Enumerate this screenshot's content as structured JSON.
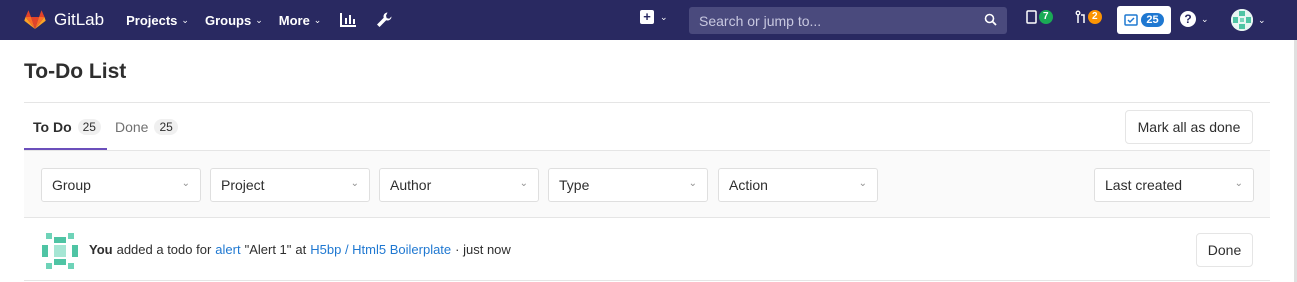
{
  "app": {
    "name": "GitLab",
    "brand_color": "#292961",
    "accent_color": "#6b4fbb"
  },
  "nav": {
    "menu": [
      {
        "label": "Projects",
        "chevron": "⌄"
      },
      {
        "label": "Groups",
        "chevron": "⌄"
      },
      {
        "label": "More",
        "chevron": "⌄"
      }
    ],
    "icons": [
      "activity-chart-icon",
      "wrench-icon"
    ],
    "new_chevron": "⌄",
    "search_placeholder": "Search or jump to...",
    "issues_count": "7",
    "merge_requests_count": "2",
    "todos_count": "25",
    "help_chevron": "⌄",
    "user_chevron": "⌄"
  },
  "page": {
    "title": "To-Do List"
  },
  "tabs": [
    {
      "label": "To Do",
      "count": "25",
      "active": true
    },
    {
      "label": "Done",
      "count": "25",
      "active": false
    }
  ],
  "mark_all_label": "Mark all as done",
  "filters": {
    "group": "Group",
    "project": "Project",
    "author": "Author",
    "type": "Type",
    "action": "Action",
    "sort": "Last created"
  },
  "todos": [
    {
      "author": "You",
      "action_text": "added a todo for",
      "target_type": "alert",
      "target_title": "\"Alert 1\"",
      "at_text": "at",
      "project": "H5bp / Html5 Boilerplate",
      "time": "· just now",
      "done_label": "Done"
    }
  ]
}
